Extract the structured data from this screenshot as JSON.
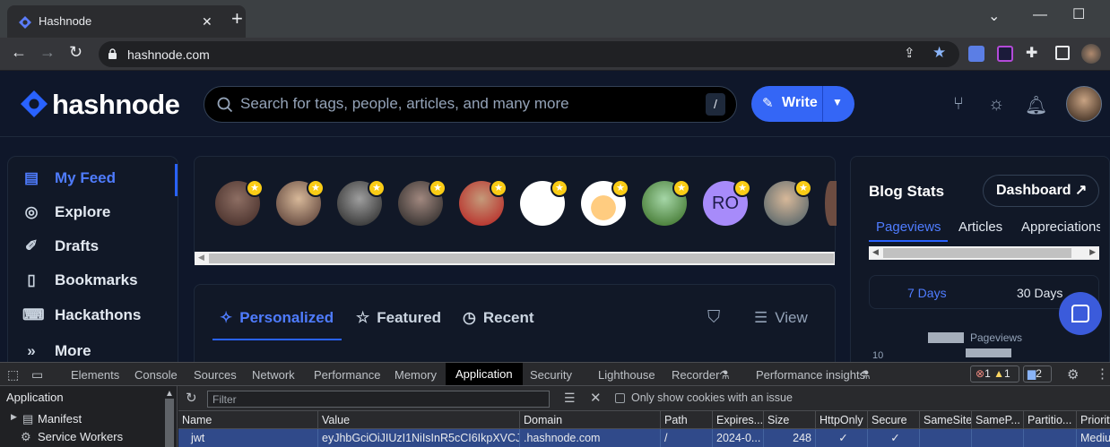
{
  "browser": {
    "tab_title": "Hashnode",
    "url": "hashnode.com",
    "new_tab": "+",
    "close_tab": "✕"
  },
  "site": {
    "logo": "hashnode",
    "search_placeholder": "Search for tags, people, articles, and many more",
    "search_shortcut": "/",
    "write_label": "Write",
    "sidebar": [
      {
        "label": "My Feed",
        "icon": "feed-icon",
        "active": true
      },
      {
        "label": "Explore",
        "icon": "compass-icon"
      },
      {
        "label": "Drafts",
        "icon": "drafts-icon"
      },
      {
        "label": "Bookmarks",
        "icon": "bookmark-icon"
      },
      {
        "label": "Hackathons",
        "icon": "hackathon-icon"
      },
      {
        "label": "More",
        "icon": "chevrons-icon"
      }
    ],
    "stories": [
      {
        "initials": ""
      },
      {
        "initials": ""
      },
      {
        "initials": ""
      },
      {
        "initials": ""
      },
      {
        "initials": ""
      },
      {
        "initials": ""
      },
      {
        "initials": ""
      },
      {
        "initials": ""
      },
      {
        "initials": "RO"
      },
      {
        "initials": ""
      }
    ],
    "feed_tabs": [
      "Personalized",
      "Featured",
      "Recent"
    ],
    "feed_view": "View",
    "blog_stats": {
      "title": "Blog Stats",
      "dashboard": "Dashboard ↗",
      "tabs": [
        "Pageviews",
        "Articles",
        "Appreciations"
      ],
      "ranges": [
        "7 Days",
        "30 Days"
      ],
      "legend": "Pageviews",
      "axis_tick": "10"
    }
  },
  "devtools": {
    "tabs": [
      "Elements",
      "Console",
      "Sources",
      "Network",
      "Performance",
      "Memory",
      "Application",
      "Security",
      "Lighthouse",
      "Recorder",
      "Performance insights"
    ],
    "active_tab": "Application",
    "errors": "1",
    "warnings": "1",
    "messages": "2",
    "sidebar_title": "Application",
    "sidebar_items": [
      "Manifest",
      "Service Workers"
    ],
    "filter_placeholder": "Filter",
    "only_issues_label": "Only show cookies with an issue",
    "columns": [
      "Name",
      "Value",
      "Domain",
      "Path",
      "Expires...",
      "Size",
      "HttpOnly",
      "Secure",
      "SameSite",
      "SameP...",
      "Partitio...",
      "Priority"
    ],
    "row": {
      "name": "jwt",
      "value": "eyJhbGciOiJIUzI1NiIsInR5cCI6IkpXVCJ9...",
      "domain": ".hashnode.com",
      "path": "/",
      "expires": "2024-0...",
      "size": "248",
      "httponly": "✓",
      "secure": "✓",
      "samesite": "",
      "samep": "",
      "partition": "",
      "priority": "Mediu"
    }
  },
  "colors": {
    "accent": "#2962ff",
    "site_bg": "#0f172a",
    "devtools_bg": "#202124",
    "selected_row": "#304a8a"
  }
}
